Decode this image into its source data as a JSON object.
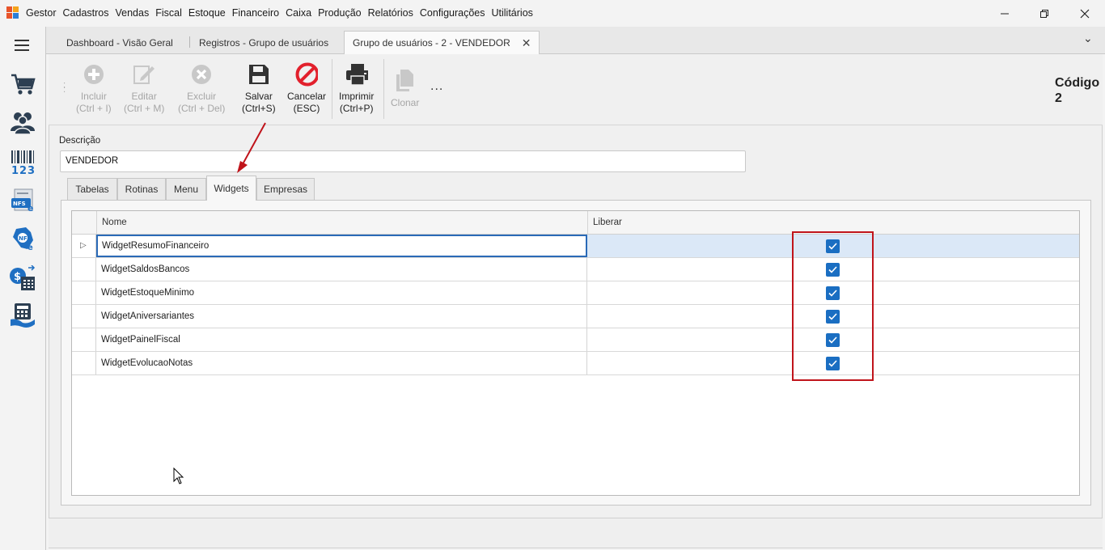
{
  "app": {
    "name": "Gestor",
    "menu": [
      "Cadastros",
      "Vendas",
      "Fiscal",
      "Estoque",
      "Financeiro",
      "Caixa",
      "Produção",
      "Relatórios",
      "Configurações",
      "Utilitários"
    ]
  },
  "window_controls": {
    "minimize": "—",
    "restore": "❐",
    "close": "✕"
  },
  "sidebar": {
    "icons": [
      "hamburger-menu-icon",
      "cart-icon",
      "users-icon",
      "barcode-icon",
      "nfse-icon",
      "nfe-icon",
      "cash-register-icon",
      "calculator-money-icon"
    ]
  },
  "tabs": [
    {
      "label": "Dashboard - Visão Geral"
    },
    {
      "label": "Registros - Grupo de usuários"
    },
    {
      "label": "Grupo de usuários - 2 - VENDEDOR",
      "active": true,
      "close": "✕"
    }
  ],
  "tab_overflow": "⌄",
  "toolbar": {
    "incluir": {
      "label": "Incluir",
      "shortcut": "(Ctrl + I)"
    },
    "editar": {
      "label": "Editar",
      "shortcut": "(Ctrl + M)"
    },
    "excluir": {
      "label": "Excluir",
      "shortcut": "(Ctrl + Del)"
    },
    "salvar": {
      "label": "Salvar",
      "shortcut": "(Ctrl+S)"
    },
    "cancelar": {
      "label": "Cancelar",
      "shortcut": "(ESC)"
    },
    "imprimir": {
      "label": "Imprimir",
      "shortcut": "(Ctrl+P)"
    },
    "clonar": {
      "label": "Clonar"
    },
    "more": "..."
  },
  "codigo": {
    "label": "Código",
    "value": "2"
  },
  "descricao": {
    "label": "Descrição",
    "value": "VENDEDOR"
  },
  "inner_tabs": [
    "Tabelas",
    "Rotinas",
    "Menu",
    "Widgets",
    "Empresas"
  ],
  "active_inner_tab": "Widgets",
  "grid": {
    "columns": {
      "nome": "Nome",
      "liberar": "Liberar"
    },
    "rows": [
      {
        "nome": "WidgetResumoFinanceiro",
        "liberar": true
      },
      {
        "nome": "WidgetSaldosBancos",
        "liberar": true
      },
      {
        "nome": "WidgetEstoqueMinimo",
        "liberar": true
      },
      {
        "nome": "WidgetAniversariantes",
        "liberar": true
      },
      {
        "nome": "WidgetPainelFiscal",
        "liberar": true
      },
      {
        "nome": "WidgetEvolucaoNotas",
        "liberar": true
      }
    ],
    "row_indicator": "▷"
  },
  "colors": {
    "accent": "#1a6ec2",
    "annotation": "#c0141b"
  }
}
